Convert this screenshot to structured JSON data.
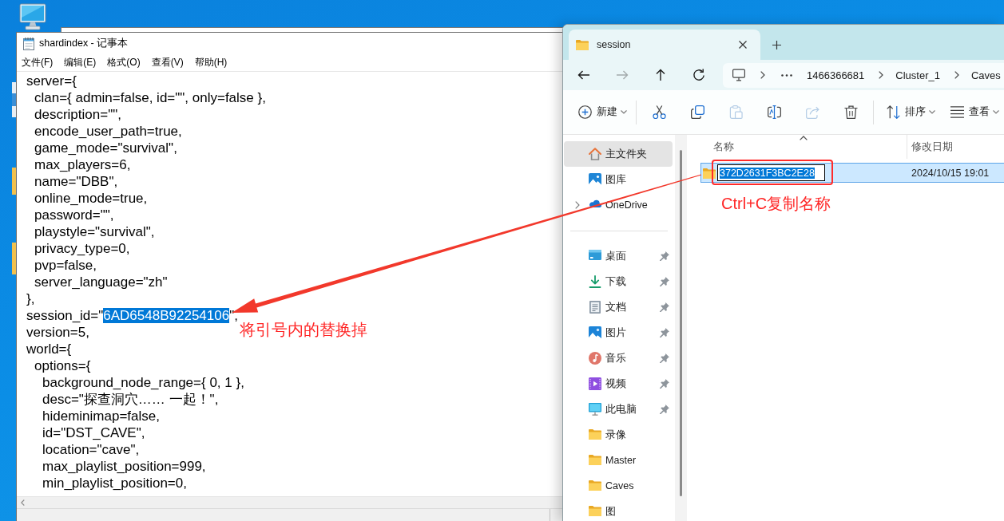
{
  "notepad": {
    "title": "shardindex - 记事本",
    "menu": [
      "文件(F)",
      "编辑(E)",
      "格式(O)",
      "查看(V)",
      "帮助(H)"
    ],
    "lines": [
      {
        "text": "server={",
        "children": [
          {
            "text": "clan={ admin=false, id=\"\", only=false },"
          },
          {
            "text": "description=\"\","
          },
          {
            "text": "encode_user_path=true,"
          },
          {
            "text": "game_mode=\"survival\","
          },
          {
            "text": "max_players=6,"
          },
          {
            "text": "name=\"DBB\","
          },
          {
            "text": "online_mode=true,"
          },
          {
            "text": "password=\"\","
          },
          {
            "text": "playstyle=\"survival\","
          },
          {
            "text": "privacy_type=0,"
          },
          {
            "text": "pvp=false,"
          },
          {
            "text": "server_language=\"zh\""
          }
        ]
      },
      {
        "text": "},"
      },
      {
        "segments": [
          {
            "text": "session_id=\"",
            "selected": false
          },
          {
            "text": "6AD6548B92254106",
            "selected": true
          },
          {
            "text": "\",",
            "selected": false
          }
        ]
      },
      {
        "text": "version=5,"
      },
      {
        "text": "world={",
        "children": [
          {
            "text": "options={",
            "children": [
              {
                "text": "background_node_range={ 0, 1 },"
              },
              {
                "text": "desc=\"探查洞穴…… 一起！\","
              },
              {
                "text": "hideminimap=false,"
              },
              {
                "text": "id=\"DST_CAVE\","
              },
              {
                "text": "location=\"cave\","
              },
              {
                "text": "max_playlist_position=999,"
              },
              {
                "text": "min_playlist_position=0,"
              }
            ]
          }
        ]
      }
    ],
    "note": "将引号内的替换掉"
  },
  "explorer": {
    "tabs": [
      {
        "label": "session",
        "selected": true
      }
    ],
    "nav": [
      {
        "kind": "back",
        "disabled": false
      },
      {
        "kind": "forward",
        "disabled": true
      },
      {
        "kind": "up",
        "disabled": false
      },
      {
        "kind": "refresh",
        "disabled": false
      }
    ],
    "address": [
      "1466366681",
      "Cluster_1",
      "Caves"
    ],
    "toolbar": [
      {
        "buttons": [
          {
            "kind": "new",
            "label": "新建",
            "dropdown": true,
            "disabled": false
          }
        ]
      },
      {
        "buttons": [
          {
            "kind": "cut",
            "dropdown": false,
            "disabled": false
          },
          {
            "kind": "copy",
            "dropdown": false,
            "disabled": false
          },
          {
            "kind": "paste",
            "dropdown": false,
            "disabled": true
          },
          {
            "kind": "rename",
            "dropdown": false,
            "disabled": false
          },
          {
            "kind": "share",
            "dropdown": false,
            "disabled": true
          },
          {
            "kind": "delete",
            "dropdown": false,
            "disabled": false
          }
        ]
      },
      {
        "buttons": [
          {
            "kind": "sort",
            "label": "排序",
            "dropdown": true,
            "disabled": false
          },
          {
            "kind": "view",
            "label": "查看",
            "dropdown": true,
            "disabled": false
          }
        ]
      }
    ],
    "sidebar": [
      {
        "items": [
          {
            "label": "主文件夹",
            "kind": "home",
            "selected": true,
            "pinned": false,
            "expandable": false
          },
          {
            "label": "图库",
            "kind": "gallery",
            "selected": false,
            "pinned": false,
            "expandable": false
          },
          {
            "label": "OneDrive",
            "kind": "cloud",
            "selected": false,
            "pinned": false,
            "expandable": true
          }
        ]
      },
      {
        "items": [
          {
            "label": "桌面",
            "kind": "desktop",
            "selected": false,
            "pinned": true,
            "expandable": false
          },
          {
            "label": "下载",
            "kind": "downloads",
            "selected": false,
            "pinned": true,
            "expandable": false
          },
          {
            "label": "文档",
            "kind": "documents",
            "selected": false,
            "pinned": true,
            "expandable": false
          },
          {
            "label": "图片",
            "kind": "pictures",
            "selected": false,
            "pinned": true,
            "expandable": false
          },
          {
            "label": "音乐",
            "kind": "music",
            "selected": false,
            "pinned": true,
            "expandable": false
          },
          {
            "label": "视频",
            "kind": "videos",
            "selected": false,
            "pinned": true,
            "expandable": false
          },
          {
            "label": "此电脑",
            "kind": "computer",
            "selected": false,
            "pinned": true,
            "expandable": false
          },
          {
            "label": "录像",
            "kind": "folder",
            "selected": false,
            "pinned": false,
            "expandable": false
          },
          {
            "label": "Master",
            "kind": "folder",
            "selected": false,
            "pinned": false,
            "expandable": false
          },
          {
            "label": "Caves",
            "kind": "folder",
            "selected": false,
            "pinned": false,
            "expandable": false
          },
          {
            "label": "图",
            "kind": "folder",
            "selected": false,
            "pinned": false,
            "expandable": false
          }
        ]
      }
    ],
    "columns": [
      {
        "label": "名称",
        "sorted": true
      },
      {
        "label": "修改日期",
        "sorted": false
      }
    ],
    "rows": [
      {
        "name": "372D2631F3BC2E28",
        "modified": "2024/10/15 19:01",
        "selected": true,
        "renaming": true
      }
    ],
    "note": "Ctrl+C复制名称"
  }
}
